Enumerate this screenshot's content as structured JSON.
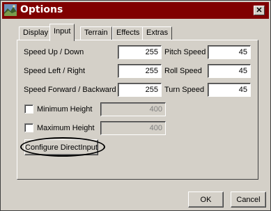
{
  "window": {
    "title": "Options",
    "close_glyph": "✕"
  },
  "tabs": [
    {
      "label": "Display"
    },
    {
      "label": "Input"
    },
    {
      "label": "Terrain"
    },
    {
      "label": "Effects"
    },
    {
      "label": "Extras"
    }
  ],
  "active_tab": "Input",
  "input": {
    "speed_up_down": {
      "label": "Speed Up / Down",
      "value": "255"
    },
    "speed_left_right": {
      "label": "Speed Left / Right",
      "value": "255"
    },
    "speed_forward_backward": {
      "label": "Speed Forward / Backward",
      "value": "255"
    },
    "pitch_speed": {
      "label": "Pitch Speed",
      "value": "45"
    },
    "roll_speed": {
      "label": "Roll Speed",
      "value": "45"
    },
    "turn_speed": {
      "label": "Turn Speed",
      "value": "45"
    },
    "minimum_height": {
      "label": "Minimum Height",
      "value": "400",
      "checked": false
    },
    "maximum_height": {
      "label": "Maximum Height",
      "value": "400",
      "checked": false
    },
    "configure_button": "Configure DirectInput"
  },
  "footer": {
    "ok_label": "OK",
    "cancel_label": "Cancel"
  },
  "colors": {
    "titlebar": "#800000",
    "face": "#d4d0c8"
  }
}
